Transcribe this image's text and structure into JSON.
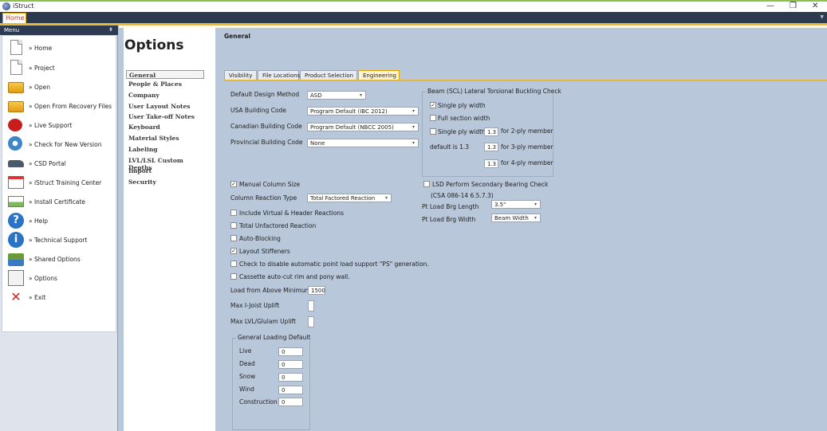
{
  "app": {
    "title": "iStruct",
    "home_tab": "Home"
  },
  "window": {
    "minimize": "—",
    "maximize": "❐",
    "close": "✕"
  },
  "sidebar": {
    "header": "Menu",
    "pin": "⇟",
    "items": [
      {
        "label": "» Home",
        "icon": "document-icon"
      },
      {
        "label": "» Project",
        "icon": "document-icon"
      },
      {
        "label": "» Open",
        "icon": "folder-icon"
      },
      {
        "label": "» Open From Recovery Files",
        "icon": "folder-icon"
      },
      {
        "label": "» Live Support",
        "icon": "phone-icon"
      },
      {
        "label": "» Check for New Version",
        "icon": "gear-icon"
      },
      {
        "label": "» CSD Portal",
        "icon": "car-icon"
      },
      {
        "label": "» iStruct Training Center",
        "icon": "calendar-icon"
      },
      {
        "label": "» Install Certificate",
        "icon": "certificate-icon"
      },
      {
        "label": "» Help",
        "icon": "help-icon",
        "glyph": "?"
      },
      {
        "label": "» Technical Support",
        "icon": "info-icon",
        "glyph": "i"
      },
      {
        "label": "» Shared Options",
        "icon": "network-icon"
      },
      {
        "label": "» Options",
        "icon": "options-icon"
      },
      {
        "label": "» Exit",
        "icon": "exit-icon",
        "glyph": "✕"
      }
    ]
  },
  "options": {
    "title": "Options",
    "categories": [
      "General",
      "People & Places",
      "Company",
      "User Layout Notes",
      "User Take-off Notes",
      "Keyboard",
      "Material Styles",
      "Labeling",
      "LVL/LSL Custom Depths",
      "Import",
      "Security"
    ],
    "selected": "General"
  },
  "section_title": "General",
  "tabs": [
    {
      "label": "Visibility"
    },
    {
      "label": "File Locations"
    },
    {
      "label": "Product Selection"
    },
    {
      "label": "Engineering",
      "active": true
    }
  ],
  "engineering": {
    "design_method": {
      "label": "Default Design Method",
      "value": "ASD"
    },
    "usa_code": {
      "label": "USA Building Code",
      "value": "Program Default (IBC 2012)"
    },
    "canadian_code": {
      "label": "Canadian Building Code",
      "value": "Program Default (NBCC 2005)"
    },
    "provincial_code": {
      "label": "Provincial Building Code",
      "value": "None"
    },
    "manual_column_size": {
      "label": "Manual Column Size",
      "checked": true
    },
    "column_reaction": {
      "label": "Column Reaction Type",
      "value": "Total Factored Reaction"
    },
    "include_virtual": {
      "label": "Include Virtual & Header Reactions",
      "checked": false
    },
    "total_unfactored": {
      "label": "Total Unfactored Reaction",
      "checked": false
    },
    "auto_blocking": {
      "label": "Auto-Blocking",
      "checked": false
    },
    "layout_stiffeners": {
      "label": "Layout Stiffeners",
      "checked": true
    },
    "disable_ps": {
      "label": "Check to disable automatic point load support \"PS\" generation.",
      "checked": false
    },
    "cassette": {
      "label": "Cassette auto-cut rim and pony wall.",
      "checked": false
    },
    "load_above_min": {
      "label": "Load from Above Minimum",
      "value": "1500"
    },
    "max_ijoist_uplift": {
      "label": "Max I-Joist Uplift",
      "value": ""
    },
    "max_lvl_uplift": {
      "label": "Max LVL/Glulam Uplift",
      "value": ""
    },
    "general_loading": {
      "title": "General Loading Default",
      "rows": [
        {
          "label": "Live",
          "value": "0"
        },
        {
          "label": "Dead",
          "value": "0"
        },
        {
          "label": "Snow",
          "value": "0"
        },
        {
          "label": "Wind",
          "value": "0"
        },
        {
          "label": "Construction",
          "value": "0"
        }
      ]
    },
    "beam_ltb": {
      "title": "Beam (SCL) Lateral Torsional Buckling Check",
      "single_ply": {
        "label": "Single ply width",
        "checked": true
      },
      "full_section": {
        "label": "Full section width",
        "checked": false
      },
      "single_ply_mult": {
        "label": "Single ply width *",
        "checked": false
      },
      "default_note": "default is 1.3",
      "rows": [
        {
          "value": "1.3",
          "label": "for 2-ply member"
        },
        {
          "value": "1.3",
          "label": "for 3-ply member"
        },
        {
          "value": "1.3",
          "label": "for 4-ply member"
        }
      ]
    },
    "lsd": {
      "label": "LSD Perform Secondary Bearing Check",
      "checked": false,
      "ref": "(CSA 086-14 6.5.7.3)",
      "pt_length": {
        "label": "Pt Load Brg Length",
        "value": "3.5\""
      },
      "pt_width": {
        "label": "Pt Load Brg Width",
        "value": "Beam Width"
      }
    }
  },
  "colors": {
    "accent": "#e7b93a",
    "ribbon": "#2c3a50",
    "background": "#b9c7da"
  }
}
